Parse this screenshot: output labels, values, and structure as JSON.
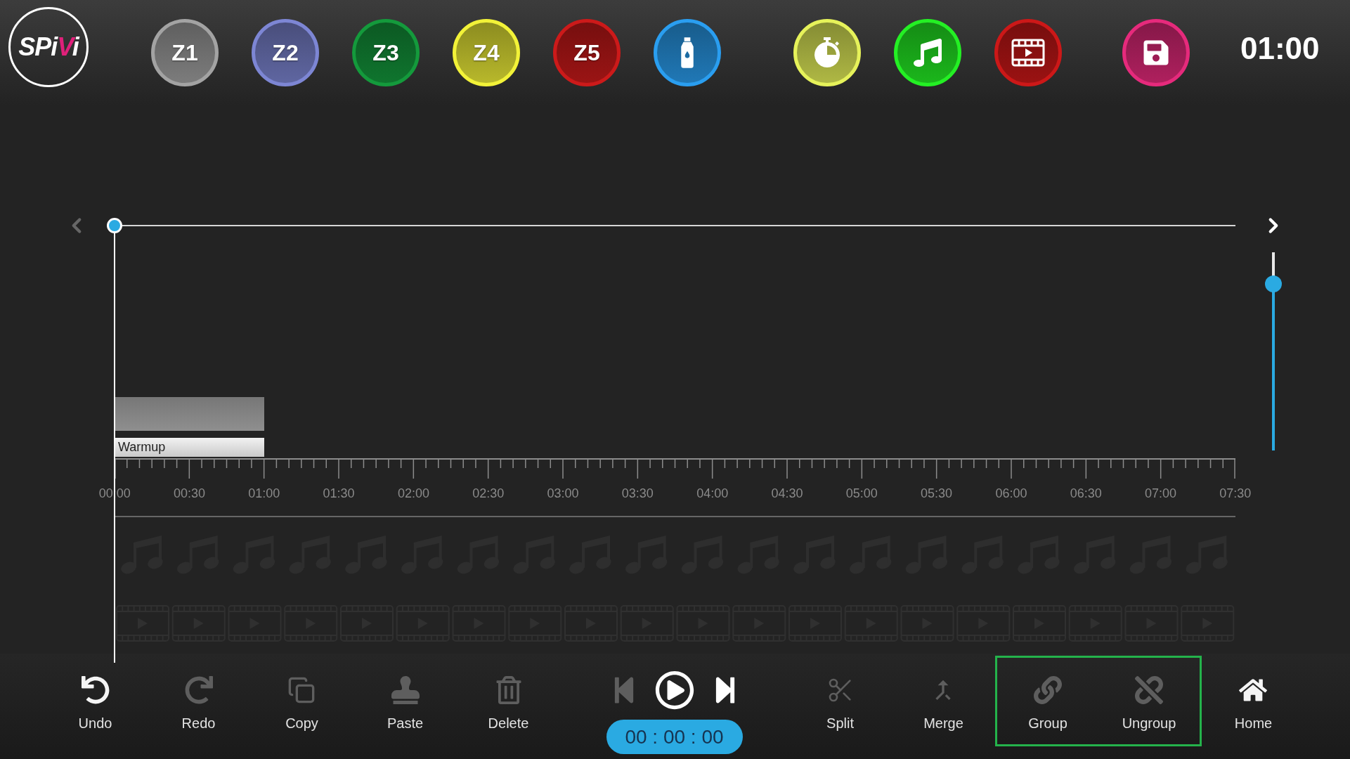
{
  "top_bar": {
    "logo": {
      "parts": [
        {
          "text": "SPi",
          "color": "#ffffff"
        },
        {
          "text": "V",
          "color": "#e0207a"
        },
        {
          "text": "i",
          "color": "#ffffff"
        }
      ]
    },
    "zone_buttons": [
      {
        "kind": "zone",
        "label": "Z1",
        "color": "#a3a3a3"
      },
      {
        "kind": "zone",
        "label": "Z2",
        "color": "#7d86d4"
      },
      {
        "kind": "zone",
        "label": "Z3",
        "color": "#149a3c"
      },
      {
        "kind": "zone",
        "label": "Z4",
        "color": "#f2f238"
      },
      {
        "kind": "zone",
        "label": "Z5",
        "color": "#cc1a1a"
      },
      {
        "kind": "water",
        "color": "#2a9ef0"
      }
    ],
    "media_buttons": [
      {
        "kind": "timer",
        "color": "#e6f25a"
      },
      {
        "kind": "music",
        "color": "#24f024"
      },
      {
        "kind": "video",
        "color": "#cc1818"
      }
    ],
    "save_button": {
      "color": "#e62a7c"
    },
    "duration": "01:00"
  },
  "timeline": {
    "scroll_left": {
      "disabled": true
    },
    "scroll_right": {
      "disabled": false
    },
    "scrubber": {
      "level": 0
    },
    "zoom_slider": {
      "level": 0.84
    },
    "segments": [
      {
        "label": "Warmup"
      }
    ],
    "ruler_labels": [
      "00:00",
      "00:30",
      "01:00",
      "01:30",
      "02:00",
      "02:30",
      "03:00",
      "03:30",
      "04:00",
      "04:30",
      "05:00",
      "05:30",
      "06:00",
      "06:30",
      "07:00",
      "07:30"
    ]
  },
  "toolbar": {
    "edit_buttons": [
      {
        "kind": "undo",
        "label": "Undo",
        "disabled": false
      },
      {
        "kind": "redo",
        "label": "Redo",
        "disabled": true
      },
      {
        "kind": "copy",
        "label": "Copy",
        "disabled": true
      },
      {
        "kind": "paste",
        "label": "Paste",
        "disabled": true
      },
      {
        "kind": "delete",
        "label": "Delete",
        "disabled": true
      }
    ],
    "transport": {
      "buttons": [
        {
          "kind": "skip-back",
          "disabled": true
        },
        {
          "kind": "play",
          "disabled": false
        },
        {
          "kind": "skip-forward",
          "disabled": false
        }
      ],
      "time": "00 : 00 : 00"
    },
    "tool_buttons": [
      {
        "kind": "split",
        "label": "Split",
        "disabled": true,
        "highlighted": false
      },
      {
        "kind": "merge",
        "label": "Merge",
        "disabled": true,
        "highlighted": false
      },
      {
        "kind": "group",
        "label": "Group",
        "disabled": true,
        "highlighted": true
      },
      {
        "kind": "ungroup",
        "label": "Ungroup",
        "disabled": true,
        "highlighted": true
      },
      {
        "kind": "home",
        "label": "Home",
        "disabled": false,
        "highlighted": false
      }
    ]
  }
}
